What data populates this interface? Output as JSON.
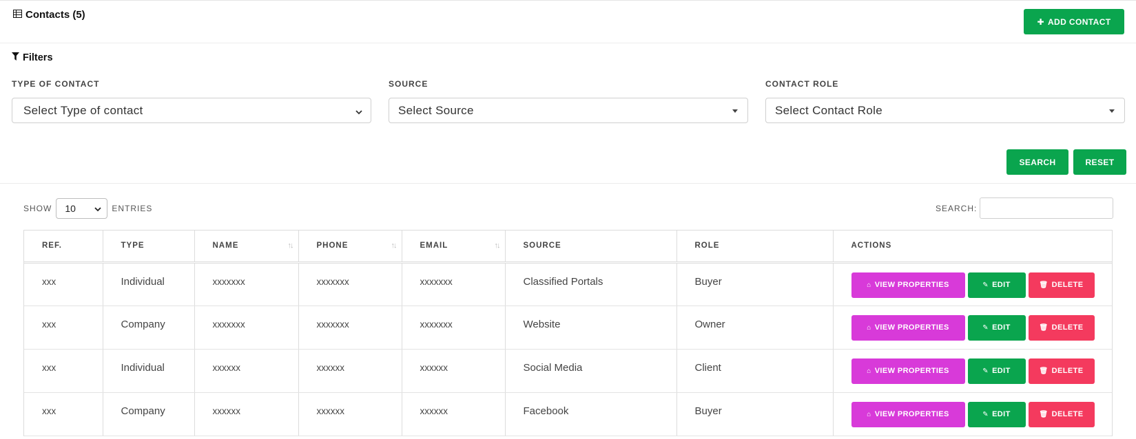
{
  "header": {
    "title": "Contacts (5)",
    "add_button": "ADD CONTACT"
  },
  "filters": {
    "title": "Filters",
    "type_label": "TYPE OF CONTACT",
    "type_placeholder": "Select Type of contact",
    "source_label": "SOURCE",
    "source_placeholder": "Select Source",
    "role_label": "CONTACT ROLE",
    "role_placeholder": "Select Contact Role",
    "search_button": "SEARCH",
    "reset_button": "RESET"
  },
  "table_controls": {
    "show_label": "SHOW",
    "entries_value": "10",
    "entries_label": "ENTRIES",
    "search_label": "SEARCH:"
  },
  "columns": [
    "REF.",
    "TYPE",
    "NAME",
    "PHONE",
    "EMAIL",
    "SOURCE",
    "ROLE",
    "ACTIONS"
  ],
  "rows": [
    {
      "ref": "xxx",
      "type": "Individual",
      "name": "xxxxxxx",
      "phone": "xxxxxxx",
      "email": "xxxxxxx",
      "source": "Classified Portals",
      "role": "Buyer"
    },
    {
      "ref": "xxx",
      "type": "Company",
      "name": "xxxxxxx",
      "phone": "xxxxxxx",
      "email": "xxxxxxx",
      "source": "Website",
      "role": "Owner"
    },
    {
      "ref": "xxx",
      "type": "Individual",
      "name": "xxxxxx",
      "phone": "xxxxxx",
      "email": "xxxxxx",
      "source": "Social Media",
      "role": "Client"
    },
    {
      "ref": "xxx",
      "type": "Company",
      "name": "xxxxxx",
      "phone": "xxxxxx",
      "email": "xxxxxx",
      "source": "Facebook",
      "role": "Buyer"
    }
  ],
  "actions": {
    "view": "VIEW PROPERTIES",
    "edit": "EDIT",
    "delete": "DELETE"
  },
  "colors": {
    "green": "#0aa54e",
    "magenta": "#d83ad9",
    "red": "#f43a5e"
  }
}
